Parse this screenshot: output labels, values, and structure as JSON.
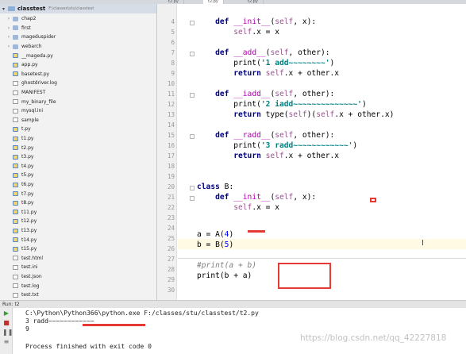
{
  "editor_tabs": [
    "t2.py",
    "t2.py",
    "t2.py"
  ],
  "project": {
    "root_name": "classtest",
    "root_path": "F:\\classes\\stu\\classtest",
    "folders": [
      "chap2",
      "first",
      "mageduspider",
      "webarch"
    ],
    "files": [
      "__mageda.py",
      "app.py",
      "basetest.py",
      "ghostdriver.log",
      "MANIFEST",
      "my_binary_file",
      "mysql.ini",
      "sample",
      "t.py",
      "t1.py",
      "t2.py",
      "t3.py",
      "t4.py",
      "t5.py",
      "t6.py",
      "t7.py",
      "t8.py",
      "t11.py",
      "t12.py",
      "t13.py",
      "t14.py",
      "t15.py",
      "test.html",
      "test.ini",
      "test.json",
      "test.log",
      "test.txt"
    ]
  },
  "editor": {
    "line_numbers": [
      "4",
      "5",
      "6",
      "7",
      "8",
      "9",
      "10",
      "11",
      "12",
      "13",
      "14",
      "15",
      "16",
      "17",
      "18",
      "19",
      "20",
      "21",
      "22",
      "23",
      "24",
      "25",
      "26",
      "27",
      "28",
      "29",
      "30"
    ]
  },
  "run": {
    "tab_label": "t2",
    "command": "C:\\Python\\Python366\\python.exe F:/classes/stu/classtest/t2.py",
    "out_line1": "3 radd~~~~~~~~~~~~",
    "out_line2": "9",
    "exit_message": "Process finished with exit code 0"
  },
  "watermark": "https://blog.csdn.net/qq_42227818",
  "colors": {
    "keyword": "#000080",
    "self": "#94558d",
    "string": "#008080",
    "number": "#0000ff",
    "annotation_red": "#e53935",
    "current_line": "#fffae3"
  }
}
